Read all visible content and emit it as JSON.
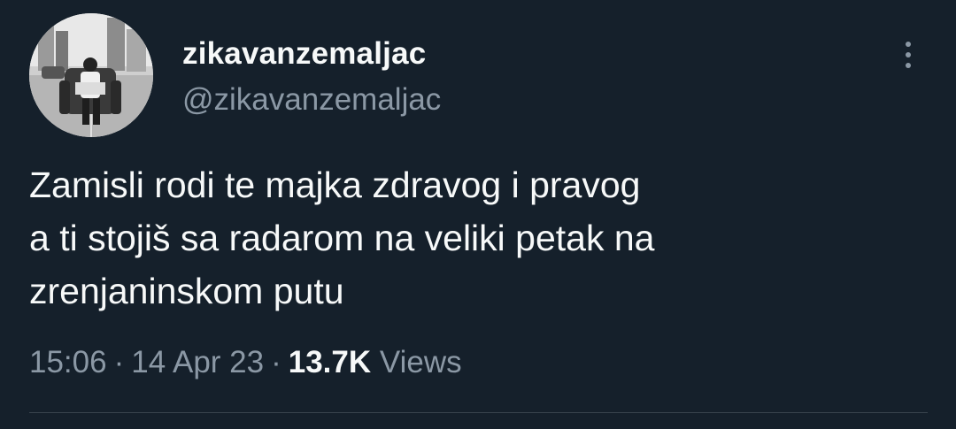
{
  "author": {
    "display_name": "zikavanzemaljac",
    "handle": "@zikavanzemaljac",
    "avatar_icon": "profile-photo"
  },
  "tweet": {
    "text_lines": [
      "Zamisli rodi te majka zdravog i pravog",
      "a ti stojiš sa radarom na veliki petak na",
      "zrenjaninskom putu"
    ],
    "time": "15:06",
    "separator": "·",
    "date": "14 Apr 23",
    "views_count": "13.7K",
    "views_label": "Views"
  },
  "more_icon": "more-options-icon",
  "colors": {
    "background": "#15202b",
    "primary_text": "#f7f9f9",
    "secondary_text": "#8b98a5",
    "divider": "#38444d"
  }
}
